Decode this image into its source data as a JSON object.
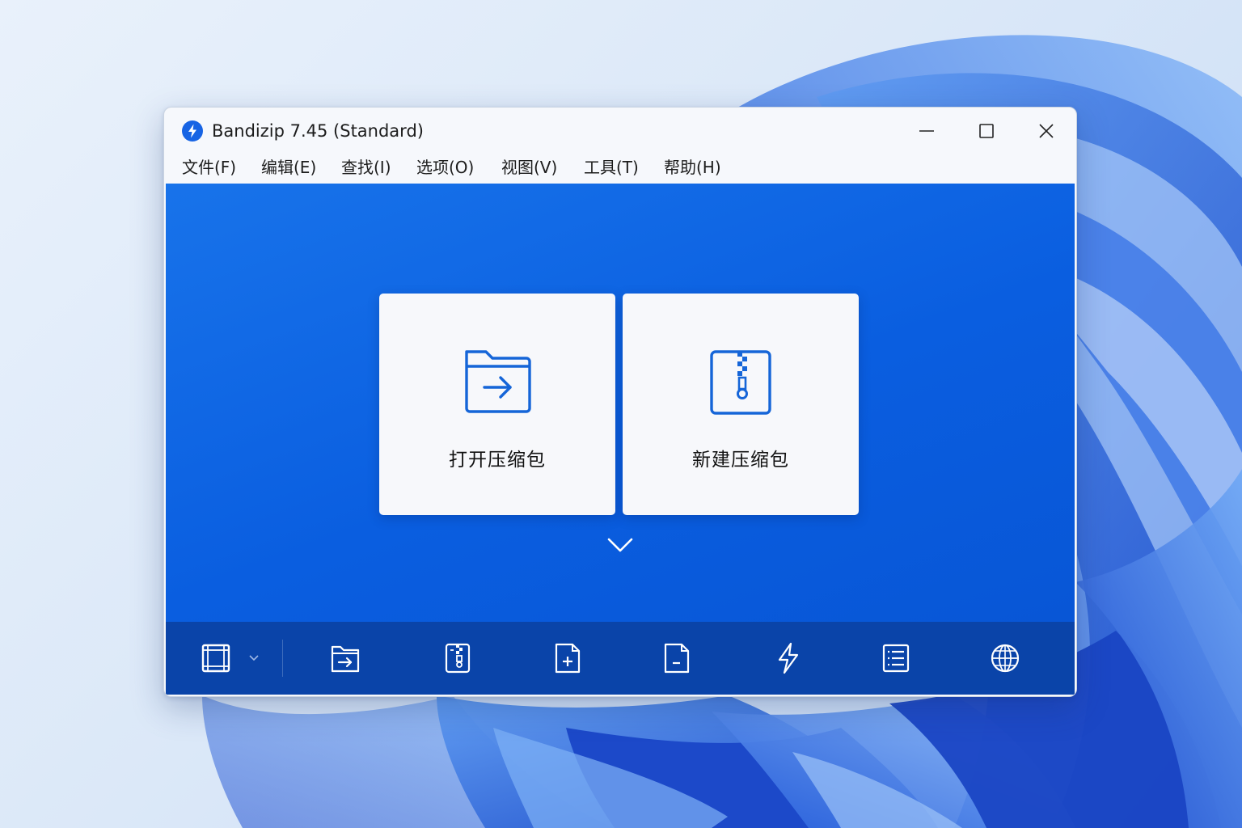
{
  "window": {
    "title": "Bandizip 7.45 (Standard)",
    "controls": [
      "minimize-icon",
      "maximize-icon",
      "close-icon"
    ]
  },
  "menu": [
    {
      "label": "文件(F)"
    },
    {
      "label": "编辑(E)"
    },
    {
      "label": "查找(I)"
    },
    {
      "label": "选项(O)"
    },
    {
      "label": "视图(V)"
    },
    {
      "label": "工具(T)"
    },
    {
      "label": "帮助(H)"
    }
  ],
  "tiles": {
    "open": {
      "label": "打开压缩包",
      "icon": "folder-open-arrow-icon"
    },
    "new": {
      "label": "新建压缩包",
      "icon": "zip-file-icon"
    }
  },
  "toolbar": {
    "icons": [
      "view-mode-icon",
      "chevron-down-icon",
      "open-archive-icon",
      "extract-icon",
      "add-file-icon",
      "delete-file-icon",
      "quick-extract-icon",
      "file-list-icon",
      "globe-icon"
    ]
  },
  "colors": {
    "main_bg": "#0a5ee0",
    "toolbar_bg": "#0a44a9",
    "accent": "#1565d8"
  }
}
